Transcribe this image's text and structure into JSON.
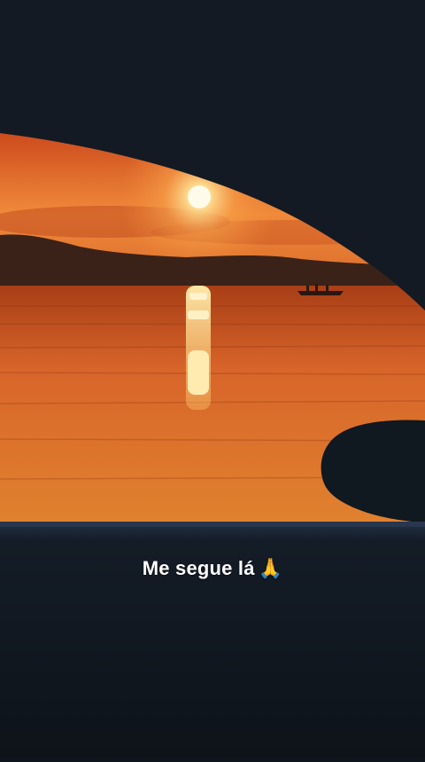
{
  "caption": {
    "text": "Me segue lá",
    "emoji": "🙏"
  },
  "scene": {
    "description_icon": "sunset-over-water-through-car-window",
    "colors": {
      "sky_top": "#d9561f",
      "sky_bottom": "#f2863a",
      "sun": "#fff4c4",
      "water_top": "#b34a1a",
      "water_bottom": "#d9782a",
      "shoreline": "#3a2418",
      "car_interior": "#141b24",
      "dashboard": "#0f151d"
    }
  }
}
